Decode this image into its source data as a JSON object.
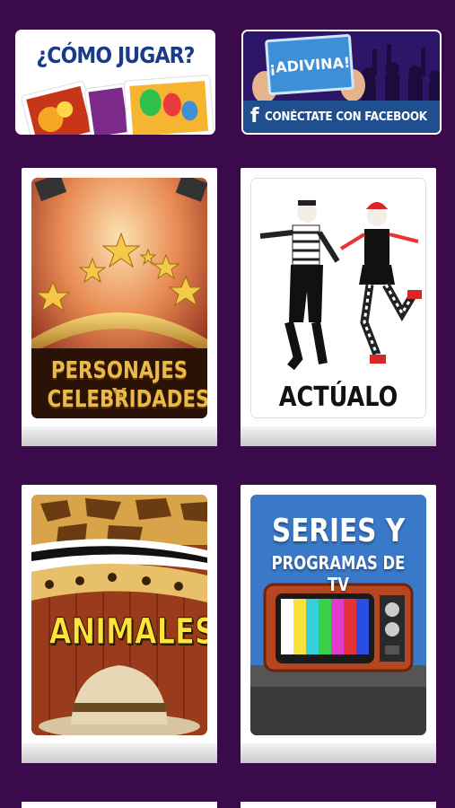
{
  "top": {
    "how_to_play": {
      "title": "¿CÓMO JUGAR?"
    },
    "facebook": {
      "sign_text": "¡ADIVINA!",
      "icon": "facebook-icon",
      "label": "CONÉCTATE CON FACEBOOK"
    }
  },
  "categories": [
    {
      "line1": "PERSONAJES Y",
      "line2": "CELEBRIDADES"
    },
    {
      "label": "ACTÚALO"
    },
    {
      "label": "ANIMALES"
    },
    {
      "line1": "SERIES Y",
      "line2": "PROGRAMAS DE TV"
    }
  ],
  "colors": {
    "background": "#3a0a4a",
    "facebook_bar": "#1f4f8f",
    "how_title": "#1a3a8a"
  }
}
